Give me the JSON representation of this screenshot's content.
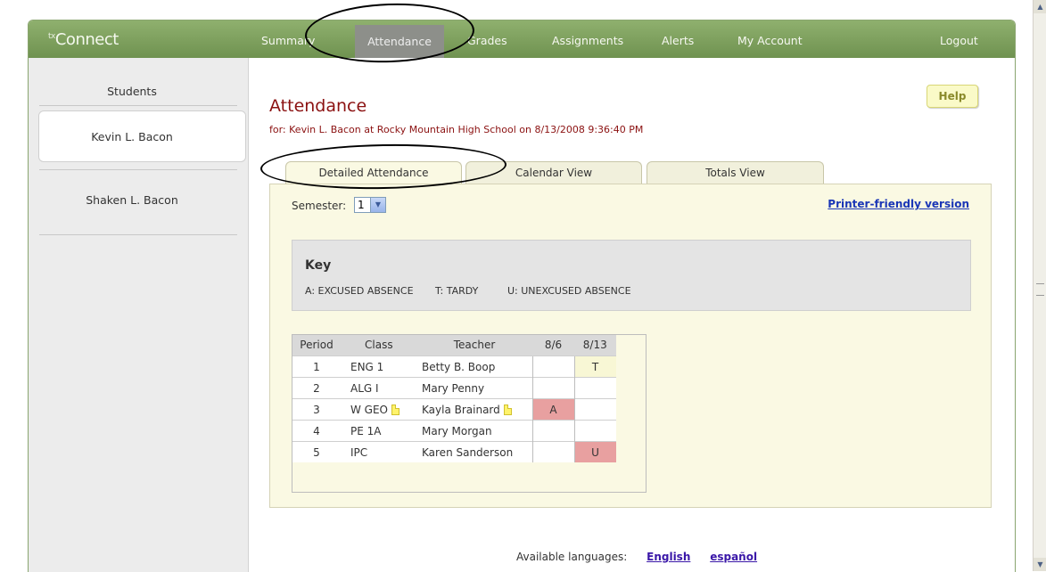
{
  "app": {
    "logo_prefix": "tx",
    "logo_name": "Connect"
  },
  "topnav": {
    "items": [
      {
        "label": "Summary"
      },
      {
        "label": "Attendance"
      },
      {
        "label": "Grades"
      },
      {
        "label": "Assignments"
      },
      {
        "label": "Alerts"
      },
      {
        "label": "My Account"
      },
      {
        "label": "Logout"
      }
    ],
    "active": "Attendance"
  },
  "sidebar": {
    "title": "Students",
    "students": [
      {
        "name": "Kevin L. Bacon",
        "selected": true
      },
      {
        "name": "Shaken L. Bacon",
        "selected": false
      }
    ]
  },
  "page": {
    "title": "Attendance",
    "subtitle": "for: Kevin L. Bacon at Rocky Mountain High School on 8/13/2008 9:36:40 PM",
    "help_label": "Help",
    "tabs": [
      {
        "label": "Detailed Attendance",
        "active": true
      },
      {
        "label": "Calendar View",
        "active": false
      },
      {
        "label": "Totals View",
        "active": false
      }
    ],
    "semester_label": "Semester:",
    "semester_value": "1",
    "printer_link": "Printer-friendly version"
  },
  "key": {
    "title": "Key",
    "items": [
      "A: EXCUSED ABSENCE",
      "T: TARDY",
      "U: UNEXCUSED ABSENCE"
    ]
  },
  "attendance_table": {
    "headers": [
      "Period",
      "Class",
      "Teacher",
      "8/6",
      "8/13"
    ],
    "rows": [
      {
        "period": "1",
        "class": "ENG 1",
        "teacher": "Betty B. Boop",
        "d1": "",
        "d2": "T"
      },
      {
        "period": "2",
        "class": "ALG I",
        "teacher": "Mary Penny",
        "d1": "",
        "d2": ""
      },
      {
        "period": "3",
        "class": "W GEO",
        "teacher": "Kayla Brainard",
        "d1": "A",
        "d2": ""
      },
      {
        "period": "4",
        "class": "PE 1A",
        "teacher": "Mary Morgan",
        "d1": "",
        "d2": ""
      },
      {
        "period": "5",
        "class": "IPC",
        "teacher": "Karen Sanderson",
        "d1": "",
        "d2": "U"
      }
    ],
    "code_colors": {
      "T": "#f8f7d5",
      "A": "#e8a0a0",
      "U": "#e8a0a0"
    }
  },
  "footer": {
    "languages_label": "Available languages:",
    "languages": [
      "English",
      "español"
    ]
  }
}
